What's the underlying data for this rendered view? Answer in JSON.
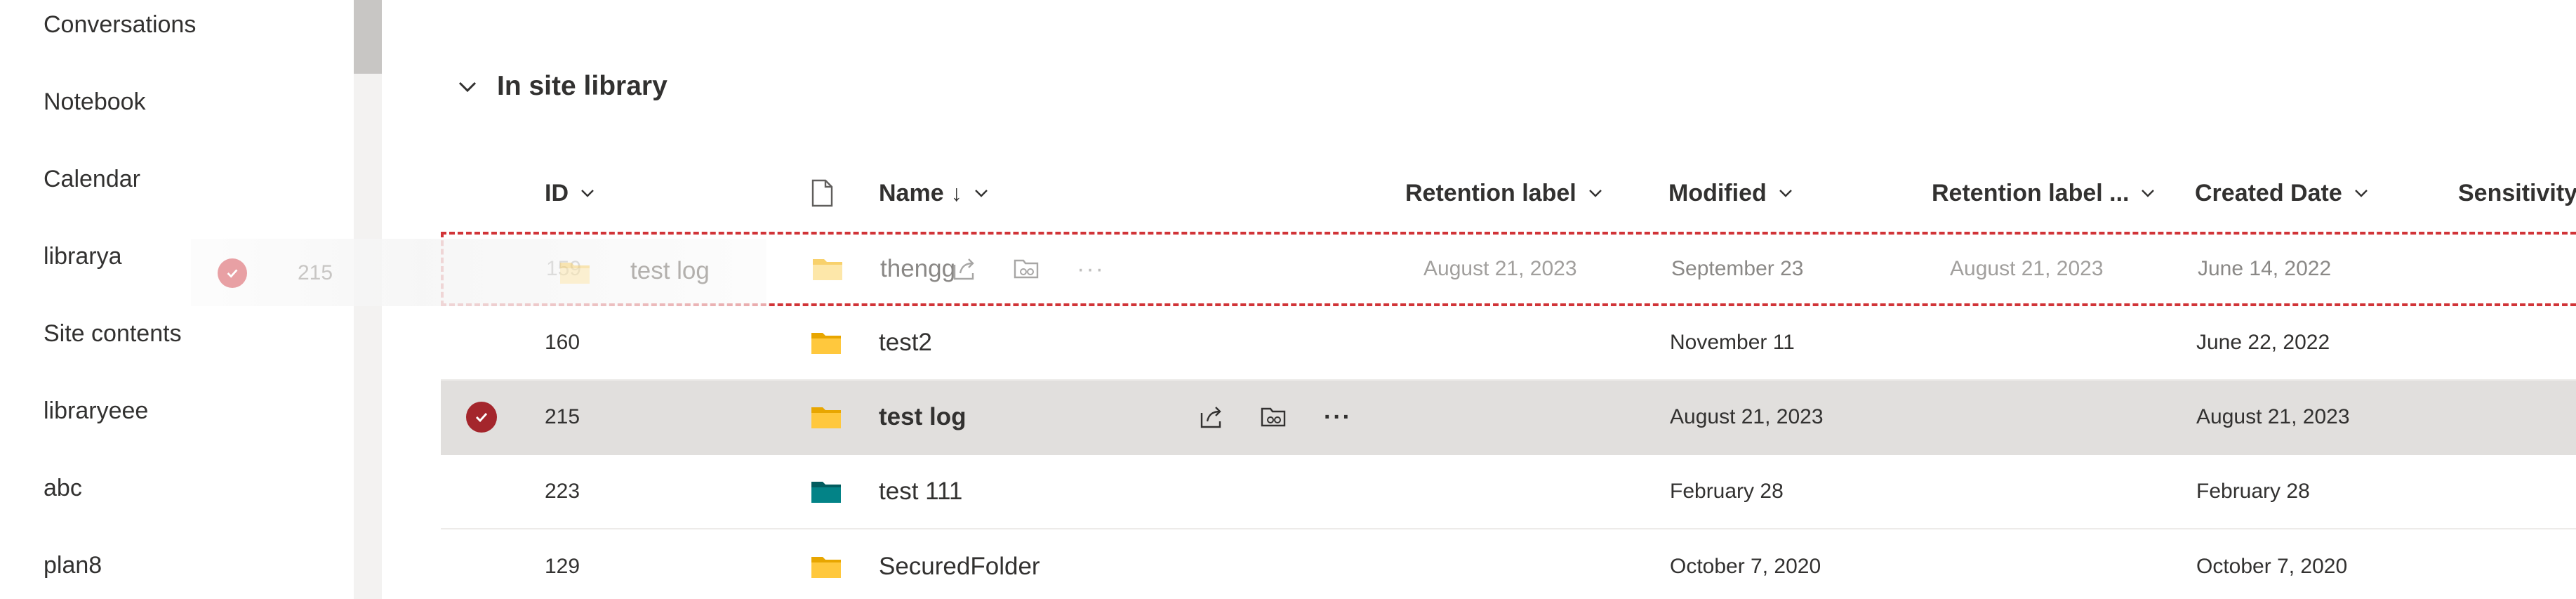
{
  "nav": {
    "items": [
      {
        "label": "Conversations"
      },
      {
        "label": "Notebook"
      },
      {
        "label": "Calendar"
      },
      {
        "label": "librarya"
      },
      {
        "label": "Site contents"
      },
      {
        "label": "libraryeee"
      },
      {
        "label": "abc"
      },
      {
        "label": "plan8"
      }
    ]
  },
  "library": {
    "group_title": "In site library",
    "columns": {
      "id": "ID",
      "name": "Name",
      "name_sort": "↓",
      "retention_label": "Retention label",
      "modified": "Modified",
      "retention_label_applied": "Retention label ...",
      "created_date": "Created Date",
      "sensitivity": "Sensitivity"
    },
    "rows": [
      {
        "id": "159",
        "name": "thengg",
        "retention": "August 21, 2023",
        "modified": "September 23",
        "retention_applied": "August 21, 2023",
        "created": "June 14, 2022",
        "folder_color": "#f8d16c"
      },
      {
        "id": "160",
        "name": "test2",
        "retention": "",
        "modified": "November 11",
        "retention_applied": "",
        "created": "June 22, 2022",
        "folder_color": "#ffb900"
      },
      {
        "id": "215",
        "name": "test log",
        "retention": "",
        "modified": "August 21, 2023",
        "retention_applied": "",
        "created": "August 21, 2023",
        "folder_color": "#ffb900"
      },
      {
        "id": "223",
        "name": "test 111",
        "retention": "",
        "modified": "February 28",
        "retention_applied": "",
        "created": "February 28",
        "folder_color": "#038387"
      },
      {
        "id": "129",
        "name": "SecuredFolder",
        "retention": "",
        "modified": "October 7, 2020",
        "retention_applied": "",
        "created": "October 7, 2020",
        "folder_color": "#ffb900"
      }
    ],
    "drag_ghost": {
      "id": "215",
      "name": "test log"
    }
  },
  "colors": {
    "selected_check": "#a4262c",
    "drop_target_border": "#d13438",
    "selected_row_bg": "#e1dfdd"
  }
}
